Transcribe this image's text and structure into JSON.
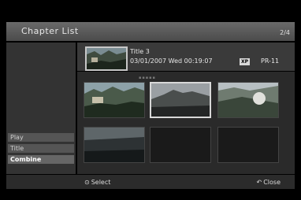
{
  "header": {
    "title": "Chapter List",
    "page": "2/4"
  },
  "info": {
    "title": "Title 3",
    "date": "03/01/2007",
    "day": "Wed",
    "time": "00:19:07",
    "mode_badge": "XP",
    "program": "PR-11",
    "scroll_indicator": "▪▪▪▪▪"
  },
  "menu": {
    "items": [
      "Play",
      "Title",
      "Combine"
    ]
  },
  "footer": {
    "select_label": "Select",
    "close_label": "Close"
  },
  "icons": {
    "select": "select-icon",
    "close": "return-icon"
  },
  "colors": {
    "panel": "#333333",
    "header": "#5a5a5a",
    "selection": "#d8d8d8"
  }
}
